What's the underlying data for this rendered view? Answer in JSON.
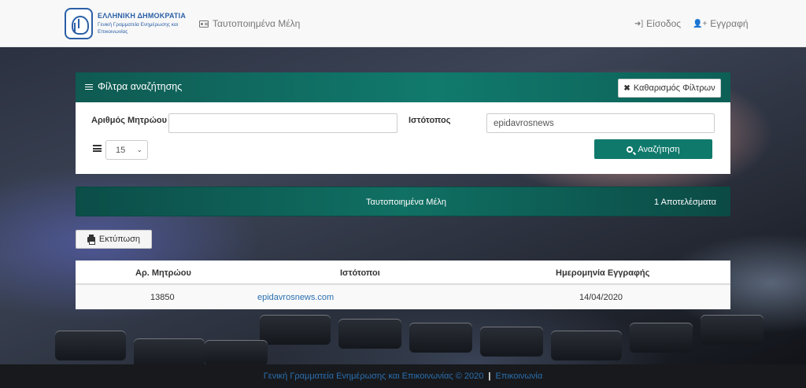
{
  "brand": {
    "title": "ΕΛΛΗΝΙΚΗ ΔΗΜΟΚΡΑΤΙΑ",
    "subtitle": "Γενική Γραμματεία Ενημέρωσης και Επικοινωνίας"
  },
  "nav": {
    "members": "Ταυτοποιημένα Μέλη",
    "login": "Είσοδος",
    "register": "Εγγραφή"
  },
  "filters": {
    "title": "Φίλτρα αναζήτησης",
    "clear_label": "Καθαρισμός Φίλτρων",
    "registry_label": "Αριθμός Μητρώου",
    "registry_value": "",
    "website_label": "Ιστότοπος",
    "website_value": "epidavrosnews",
    "page_size": "15",
    "search_label": "Αναζήτηση"
  },
  "results": {
    "title": "Ταυτοποιημένα Μέλη",
    "count": "1 Αποτελέσματα"
  },
  "print_label": "Εκτύπωση",
  "table": {
    "headers": [
      "Αρ. Μητρώου",
      "Ιστότοποι",
      "Ημερομηνία Εγγραφής"
    ],
    "rows": [
      {
        "registry": "13850",
        "website": "epidavrosnews.com",
        "date": "14/04/2020"
      }
    ]
  },
  "footer": {
    "text": "Γενική Γραμματεία Ενημέρωσης και Επικοινωνίας © 2020",
    "separator": "|",
    "contact": "Επικοινωνία"
  },
  "colors": {
    "accent": "#0f7a6c",
    "link": "#2a6fb0",
    "brand": "#2b5fa6"
  }
}
